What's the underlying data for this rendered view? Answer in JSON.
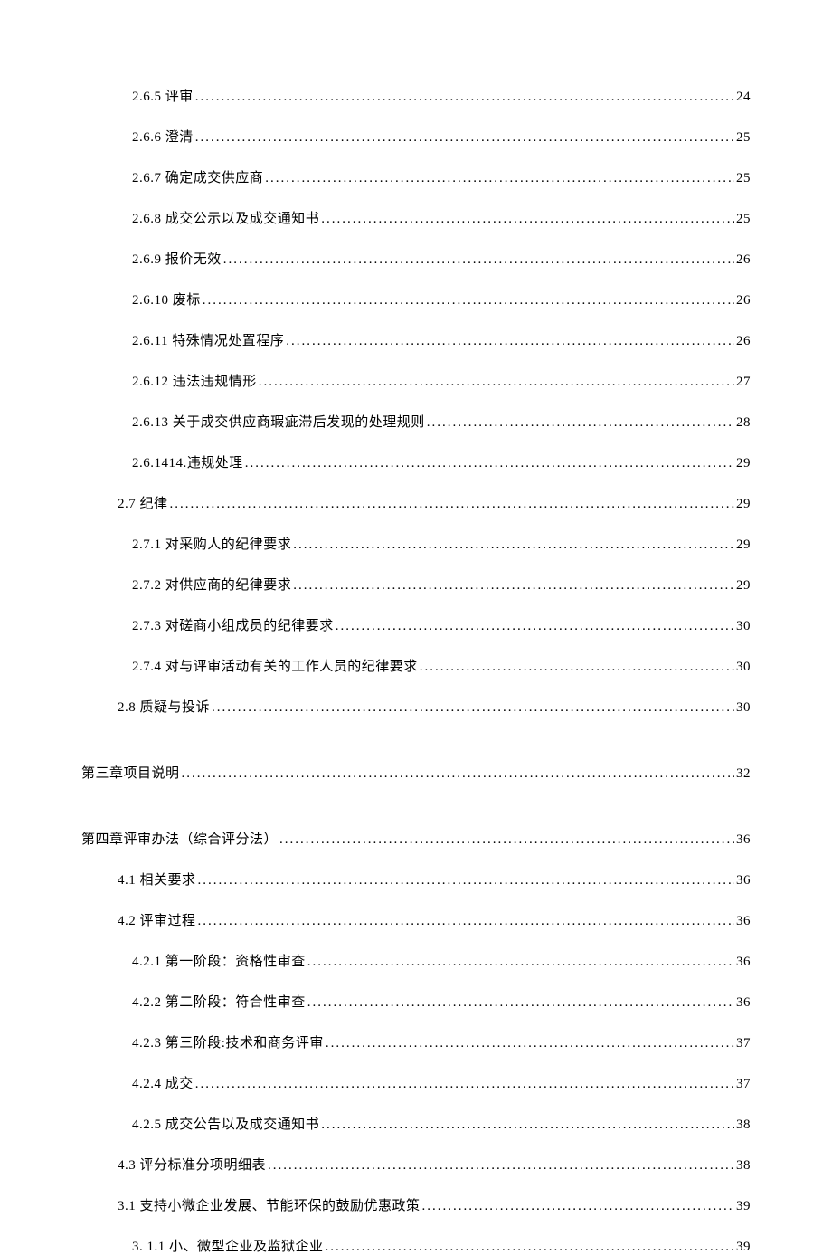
{
  "toc": [
    {
      "indent": 2,
      "label": "2.6.5 评审 ",
      "page": "24"
    },
    {
      "indent": 2,
      "label": "2.6.6 澄清 ",
      "page": "25"
    },
    {
      "indent": 2,
      "label": "2.6.7 确定成交供应商 ",
      "page": "25"
    },
    {
      "indent": 2,
      "label": "2.6.8 成交公示以及成交通知书 ",
      "page": "25"
    },
    {
      "indent": 2,
      "label": "2.6.9 报价无效 ",
      "page": "26"
    },
    {
      "indent": 2,
      "label": "2.6.10 废标 ",
      "page": "26"
    },
    {
      "indent": 2,
      "label": "2.6.11 特殊情况处置程序 ",
      "page": "26"
    },
    {
      "indent": 2,
      "label": "2.6.12 违法违规情形 ",
      "page": "27"
    },
    {
      "indent": 2,
      "label": "2.6.13 关于成交供应商瑕疵滞后发现的处理规则 ",
      "page": "28"
    },
    {
      "indent": 2,
      "label": "2.6.1414.违规处理",
      "page": "29"
    },
    {
      "indent": 1,
      "label": "2.7 纪律",
      "page": "29"
    },
    {
      "indent": 2,
      "label": "2.7.1 对采购人的纪律要求 ",
      "page": "29"
    },
    {
      "indent": 2,
      "label": "2.7.2 对供应商的纪律要求 ",
      "page": "29"
    },
    {
      "indent": 2,
      "label": "2.7.3 对磋商小组成员的纪律要求 ",
      "page": "30"
    },
    {
      "indent": 2,
      "label": "2.7.4 对与评审活动有关的工作人员的纪律要求 ",
      "page": "30"
    },
    {
      "indent": 1,
      "label": "2.8 质疑与投诉",
      "page": "30"
    },
    {
      "gap": true
    },
    {
      "indent": 0,
      "label": "第三章项目说明",
      "page": "32"
    },
    {
      "gap": true
    },
    {
      "indent": 0,
      "label": "第四章评审办法（综合评分法）",
      "page": "36"
    },
    {
      "indent": 1,
      "label": "4.1 相关要求",
      "page": "36"
    },
    {
      "indent": 1,
      "label": "4.2 评审过程",
      "page": "36"
    },
    {
      "indent": 2,
      "label": "4.2.1 第一阶段：资格性审查 ",
      "page": "36"
    },
    {
      "indent": 2,
      "label": "4.2.2 第二阶段：符合性审查 ",
      "page": "36"
    },
    {
      "indent": 2,
      "label": "4.2.3 第三阶段:技术和商务评审 ",
      "page": "37"
    },
    {
      "indent": 2,
      "label": "4.2.4  成交 ",
      "page": "37"
    },
    {
      "indent": 2,
      "label": "4.2.5 成交公告以及成交通知书 ",
      "page": "38"
    },
    {
      "indent": 1,
      "label": "4.3 评分标准分项明细表",
      "page": "38"
    },
    {
      "indent": 1,
      "label": "3.1 支持小微企业发展、节能环保的鼓励优惠政策",
      "page": "39"
    },
    {
      "indent": 2,
      "label": "3. 1.1 小、微型企业及监狱企业 ",
      "page": "39"
    }
  ]
}
